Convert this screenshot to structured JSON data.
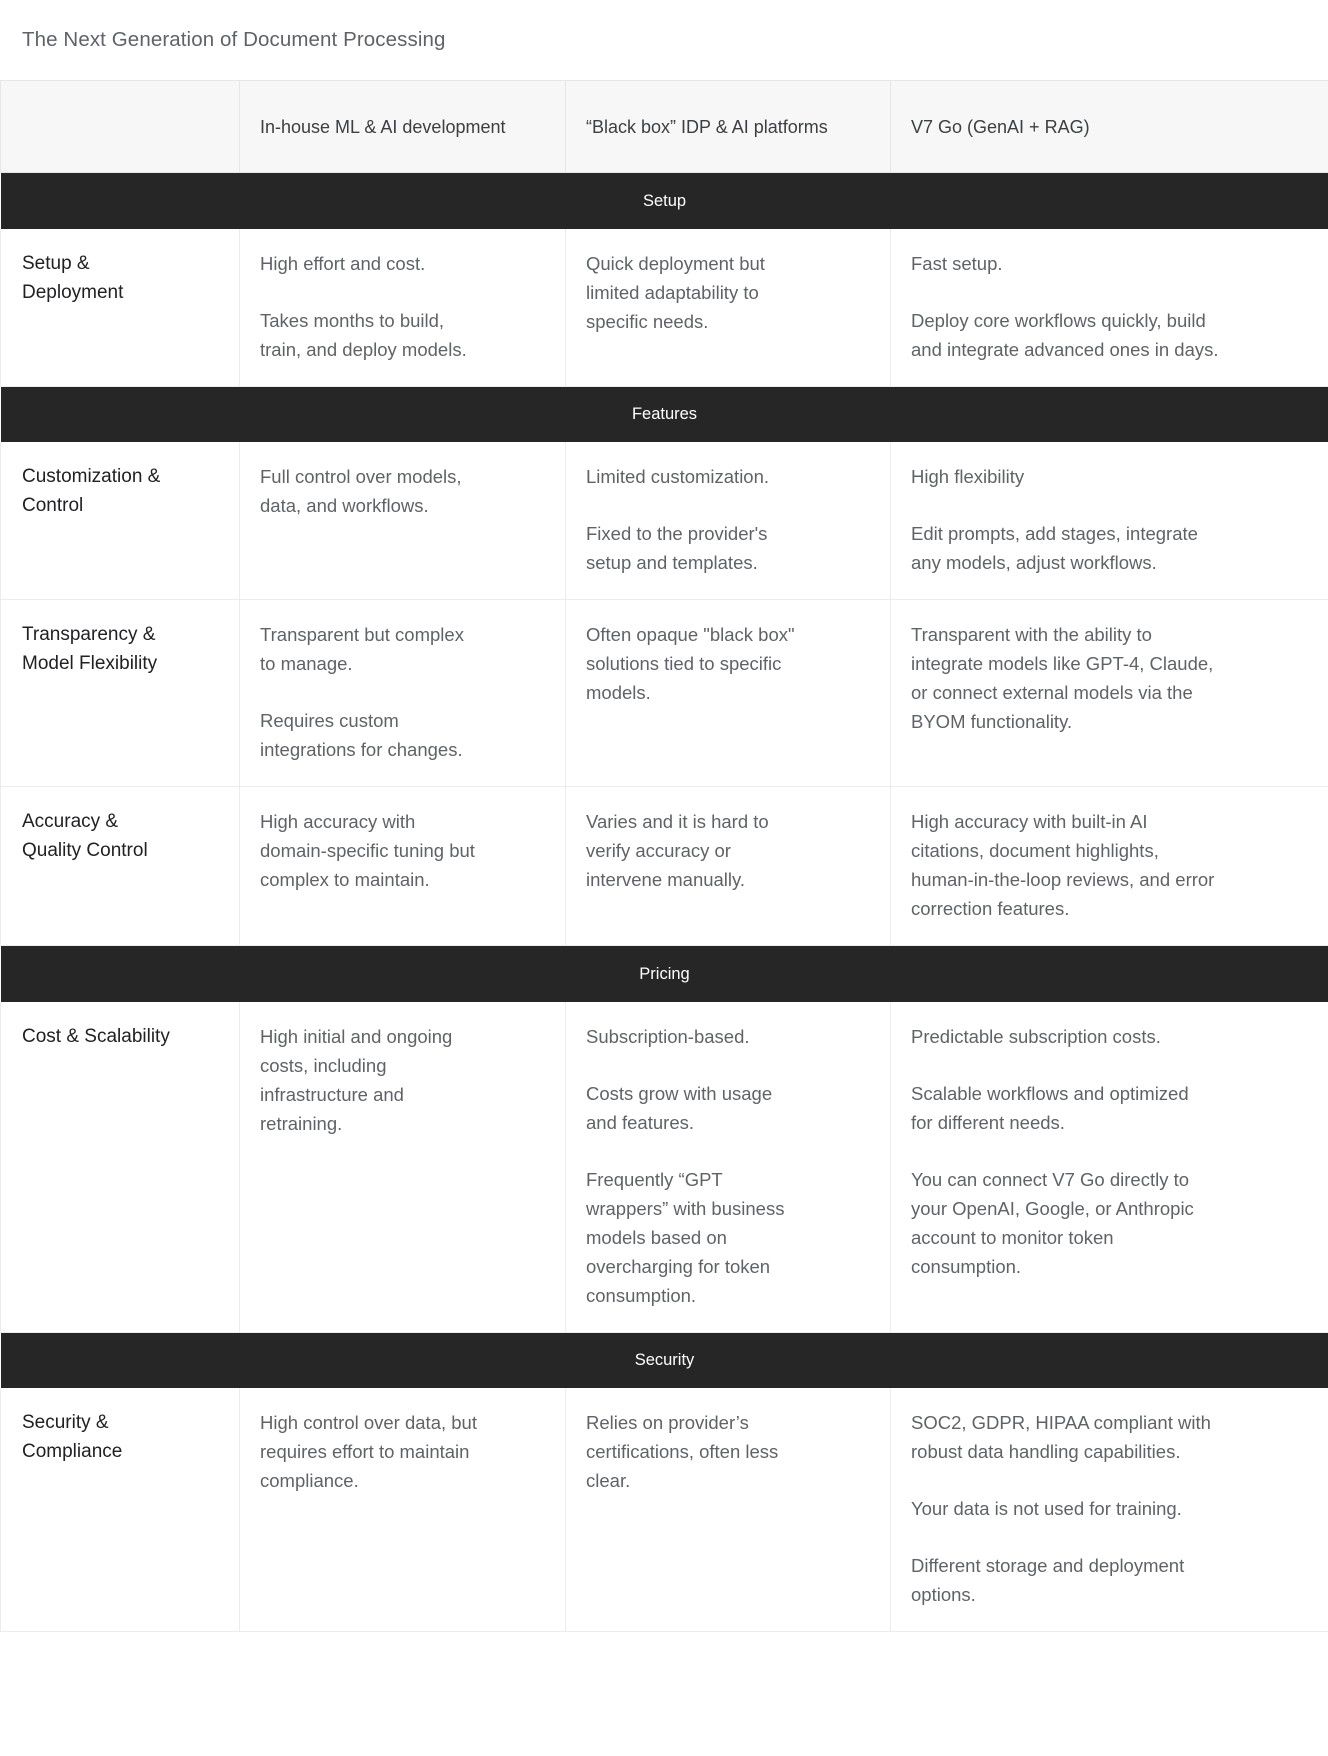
{
  "page": {
    "title": "The Next Generation of Document Processing"
  },
  "table": {
    "columns": [
      "",
      "In-house ML & AI development",
      "“Black box” IDP & AI platforms",
      "V7 Go (GenAI + RAG)"
    ],
    "sections": [
      {
        "name": "Setup",
        "rows": [
          {
            "label": "Setup &\nDeployment",
            "cells": [
              [
                "High effort and cost.",
                "Takes months to build,\ntrain, and deploy models."
              ],
              [
                "Quick deployment but\nlimited adaptability to\nspecific needs."
              ],
              [
                "Fast setup.",
                "Deploy core workflows quickly, build\nand integrate advanced ones in days."
              ]
            ]
          }
        ]
      },
      {
        "name": "Features",
        "rows": [
          {
            "label": "Customization &\nControl",
            "cells": [
              [
                "Full control over models,\ndata, and workflows."
              ],
              [
                "Limited customization.",
                "Fixed to the provider's\nsetup and templates."
              ],
              [
                "High flexibility",
                "Edit prompts, add stages,  integrate\nany models, adjust workflows."
              ]
            ]
          },
          {
            "label": "Transparency &\nModel Flexibility",
            "cells": [
              [
                "Transparent but complex\nto manage.",
                "Requires custom\nintegrations for changes."
              ],
              [
                "Often opaque \"black box\"\nsolutions tied to specific\nmodels."
              ],
              [
                "Transparent with the ability to\nintegrate models like GPT-4, Claude,\nor connect external models via the\nBYOM functionality."
              ]
            ]
          },
          {
            "label": "Accuracy &\nQuality Control",
            "cells": [
              [
                "High accuracy with\ndomain-specific tuning but\ncomplex to maintain."
              ],
              [
                "Varies and it is hard to\nverify accuracy or\nintervene manually."
              ],
              [
                "High accuracy with built-in AI\ncitations, document highlights,\nhuman-in-the-loop reviews, and error\ncorrection features."
              ]
            ]
          }
        ]
      },
      {
        "name": "Pricing",
        "rows": [
          {
            "label": "Cost & Scalability",
            "cells": [
              [
                "High initial and ongoing\ncosts, including\ninfrastructure and\nretraining."
              ],
              [
                "Subscription-based.",
                "Costs grow with usage\nand features.",
                "Frequently “GPT\nwrappers” with business\nmodels based on\novercharging for token\nconsumption."
              ],
              [
                "Predictable subscription costs.",
                "Scalable workflows and optimized\nfor different needs.",
                "You can connect V7 Go directly to\nyour OpenAI, Google, or Anthropic\naccount to monitor token\nconsumption."
              ]
            ]
          }
        ]
      },
      {
        "name": "Security",
        "rows": [
          {
            "label": "Security &\nCompliance",
            "cells": [
              [
                "High control over data, but\nrequires effort to maintain\ncompliance."
              ],
              [
                "Relies on provider’s\ncertifications, often less\nclear."
              ],
              [
                "SOC2, GDPR, HIPAA compliant with\nrobust data handling capabilities.",
                "Your data is not used for training.",
                "Different storage and deployment\noptions."
              ]
            ]
          }
        ]
      }
    ]
  },
  "colors": {
    "section_band": "#262626",
    "header_bg": "#f7f7f7",
    "body_text": "#5f6368",
    "label_text": "#202124",
    "border": "#ececec"
  }
}
